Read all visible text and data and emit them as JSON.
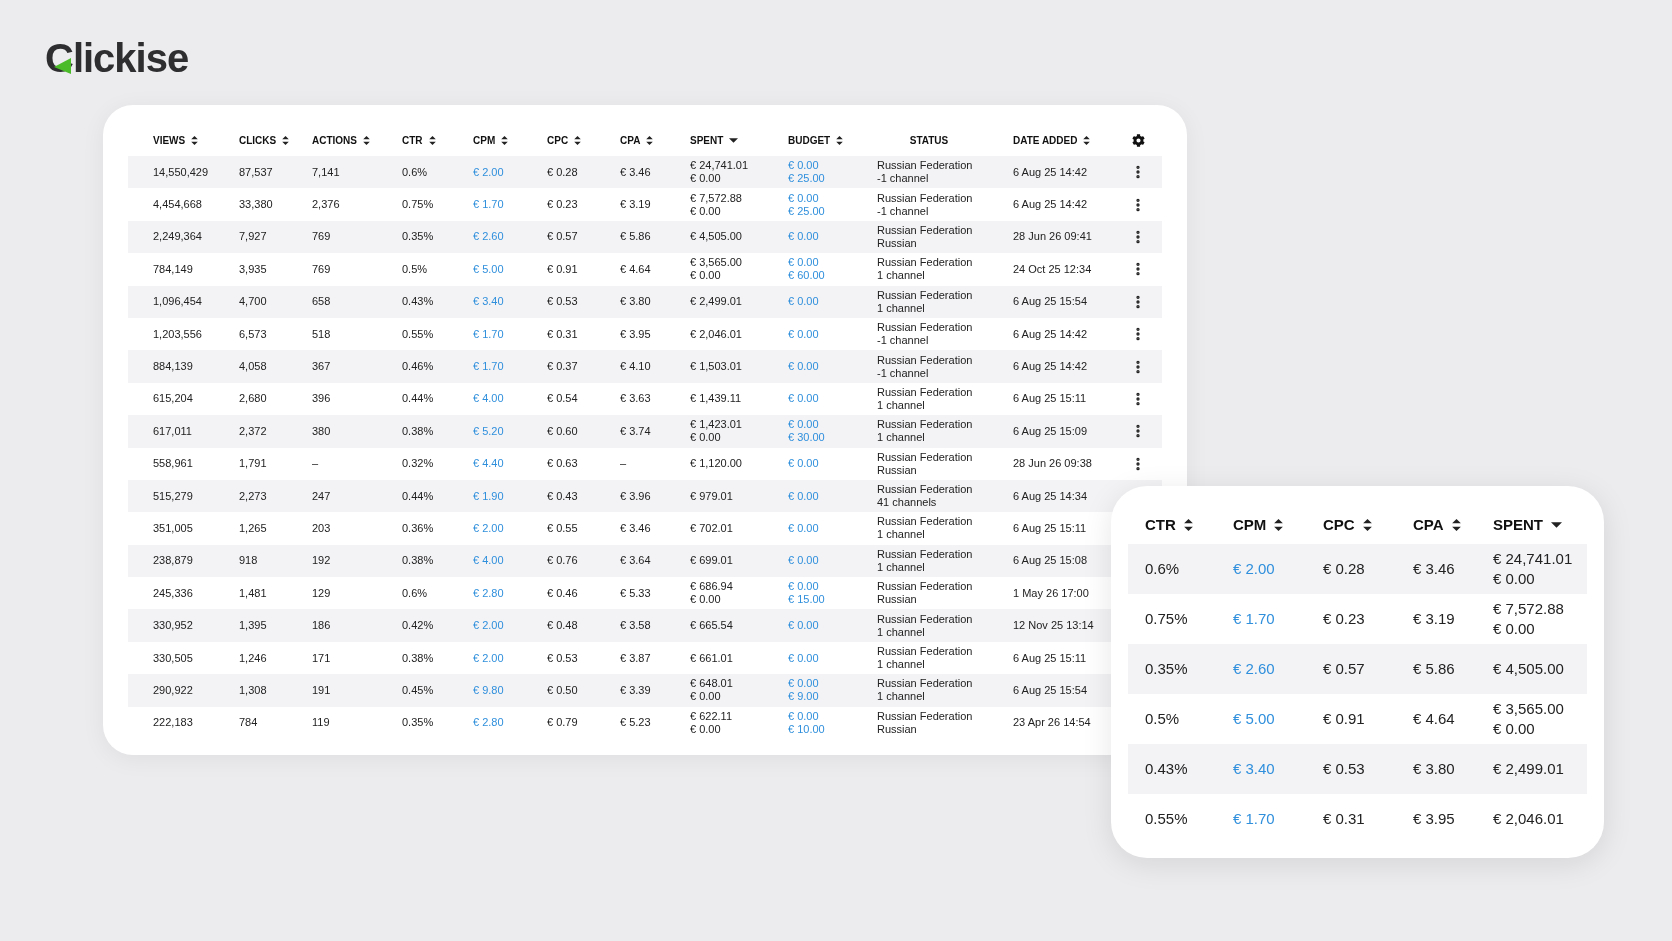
{
  "logo": "Clickise",
  "table": {
    "columns": [
      {
        "label": "VIEWS",
        "sortable": true,
        "sorted": false,
        "link": false
      },
      {
        "label": "CLICKS",
        "sortable": true,
        "sorted": false,
        "link": false
      },
      {
        "label": "ACTIONS",
        "sortable": true,
        "sorted": false,
        "link": false
      },
      {
        "label": "CTR",
        "sortable": true,
        "sorted": false,
        "link": false
      },
      {
        "label": "CPM",
        "sortable": true,
        "sorted": false,
        "link": true
      },
      {
        "label": "CPC",
        "sortable": true,
        "sorted": false,
        "link": false
      },
      {
        "label": "CPA",
        "sortable": true,
        "sorted": false,
        "link": false
      },
      {
        "label": "SPENT",
        "sortable": true,
        "sorted": true,
        "link": false
      },
      {
        "label": "BUDGET",
        "sortable": true,
        "sorted": false,
        "link": true
      },
      {
        "label": "STATUS",
        "sortable": false,
        "sorted": false,
        "link": false
      },
      {
        "label": "DATE ADDED",
        "sortable": true,
        "sorted": false,
        "link": false
      }
    ],
    "rows": [
      {
        "cells": [
          [
            "14,550,429"
          ],
          [
            "87,537"
          ],
          [
            "7,141"
          ],
          [
            "0.6%"
          ],
          [
            "€ 2.00"
          ],
          [
            "€ 0.28"
          ],
          [
            "€ 3.46"
          ],
          [
            "€ 24,741.01",
            "€ 0.00"
          ],
          [
            "€ 0.00",
            "€ 25.00"
          ],
          [
            "Russian Federation",
            "-1 channel"
          ],
          [
            "6 Aug 25 14:42"
          ]
        ]
      },
      {
        "cells": [
          [
            "4,454,668"
          ],
          [
            "33,380"
          ],
          [
            "2,376"
          ],
          [
            "0.75%"
          ],
          [
            "€ 1.70"
          ],
          [
            "€ 0.23"
          ],
          [
            "€ 3.19"
          ],
          [
            "€ 7,572.88",
            "€ 0.00"
          ],
          [
            "€ 0.00",
            "€ 25.00"
          ],
          [
            "Russian Federation",
            "-1 channel"
          ],
          [
            "6 Aug 25 14:42"
          ]
        ]
      },
      {
        "cells": [
          [
            "2,249,364"
          ],
          [
            "7,927"
          ],
          [
            "769"
          ],
          [
            "0.35%"
          ],
          [
            "€ 2.60"
          ],
          [
            "€ 0.57"
          ],
          [
            "€ 5.86"
          ],
          [
            "€ 4,505.00"
          ],
          [
            "€ 0.00"
          ],
          [
            "Russian Federation",
            "Russian"
          ],
          [
            "28 Jun 26 09:41"
          ]
        ]
      },
      {
        "cells": [
          [
            "784,149"
          ],
          [
            "3,935"
          ],
          [
            "769"
          ],
          [
            "0.5%"
          ],
          [
            "€ 5.00"
          ],
          [
            "€ 0.91"
          ],
          [
            "€ 4.64"
          ],
          [
            "€ 3,565.00",
            "€ 0.00"
          ],
          [
            "€ 0.00",
            "€ 60.00"
          ],
          [
            "Russian Federation",
            "1 channel"
          ],
          [
            "24 Oct 25 12:34"
          ]
        ]
      },
      {
        "cells": [
          [
            "1,096,454"
          ],
          [
            "4,700"
          ],
          [
            "658"
          ],
          [
            "0.43%"
          ],
          [
            "€ 3.40"
          ],
          [
            "€ 0.53"
          ],
          [
            "€ 3.80"
          ],
          [
            "€ 2,499.01"
          ],
          [
            "€ 0.00"
          ],
          [
            "Russian Federation",
            "1 channel"
          ],
          [
            "6 Aug 25 15:54"
          ]
        ]
      },
      {
        "cells": [
          [
            "1,203,556"
          ],
          [
            "6,573"
          ],
          [
            "518"
          ],
          [
            "0.55%"
          ],
          [
            "€ 1.70"
          ],
          [
            "€ 0.31"
          ],
          [
            "€ 3.95"
          ],
          [
            "€ 2,046.01"
          ],
          [
            "€ 0.00"
          ],
          [
            "Russian Federation",
            "-1 channel"
          ],
          [
            "6 Aug 25 14:42"
          ]
        ]
      },
      {
        "cells": [
          [
            "884,139"
          ],
          [
            "4,058"
          ],
          [
            "367"
          ],
          [
            "0.46%"
          ],
          [
            "€ 1.70"
          ],
          [
            "€ 0.37"
          ],
          [
            "€ 4.10"
          ],
          [
            "€ 1,503.01"
          ],
          [
            "€ 0.00"
          ],
          [
            "Russian Federation",
            "-1 channel"
          ],
          [
            "6 Aug 25 14:42"
          ]
        ]
      },
      {
        "cells": [
          [
            "615,204"
          ],
          [
            "2,680"
          ],
          [
            "396"
          ],
          [
            "0.44%"
          ],
          [
            "€ 4.00"
          ],
          [
            "€ 0.54"
          ],
          [
            "€ 3.63"
          ],
          [
            "€ 1,439.11"
          ],
          [
            "€ 0.00"
          ],
          [
            "Russian Federation",
            "1 channel"
          ],
          [
            "6 Aug 25 15:11"
          ]
        ]
      },
      {
        "cells": [
          [
            "617,011"
          ],
          [
            "2,372"
          ],
          [
            "380"
          ],
          [
            "0.38%"
          ],
          [
            "€ 5.20"
          ],
          [
            "€ 0.60"
          ],
          [
            "€ 3.74"
          ],
          [
            "€ 1,423.01",
            "€ 0.00"
          ],
          [
            "€ 0.00",
            "€ 30.00"
          ],
          [
            "Russian Federation",
            "1 channel"
          ],
          [
            "6 Aug 25 15:09"
          ]
        ]
      },
      {
        "cells": [
          [
            "558,961"
          ],
          [
            "1,791"
          ],
          [
            "–"
          ],
          [
            "0.32%"
          ],
          [
            "€ 4.40"
          ],
          [
            "€ 0.63"
          ],
          [
            "–"
          ],
          [
            "€ 1,120.00"
          ],
          [
            "€ 0.00"
          ],
          [
            "Russian Federation",
            "Russian"
          ],
          [
            "28 Jun 26 09:38"
          ]
        ]
      },
      {
        "cells": [
          [
            "515,279"
          ],
          [
            "2,273"
          ],
          [
            "247"
          ],
          [
            "0.44%"
          ],
          [
            "€ 1.90"
          ],
          [
            "€ 0.43"
          ],
          [
            "€ 3.96"
          ],
          [
            "€ 979.01"
          ],
          [
            "€ 0.00"
          ],
          [
            "Russian Federation",
            "41 channels"
          ],
          [
            "6 Aug 25 14:34"
          ]
        ]
      },
      {
        "cells": [
          [
            "351,005"
          ],
          [
            "1,265"
          ],
          [
            "203"
          ],
          [
            "0.36%"
          ],
          [
            "€ 2.00"
          ],
          [
            "€ 0.55"
          ],
          [
            "€ 3.46"
          ],
          [
            "€ 702.01"
          ],
          [
            "€ 0.00"
          ],
          [
            "Russian Federation",
            "1 channel"
          ],
          [
            "6 Aug 25 15:11"
          ]
        ]
      },
      {
        "cells": [
          [
            "238,879"
          ],
          [
            "918"
          ],
          [
            "192"
          ],
          [
            "0.38%"
          ],
          [
            "€ 4.00"
          ],
          [
            "€ 0.76"
          ],
          [
            "€ 3.64"
          ],
          [
            "€ 699.01"
          ],
          [
            "€ 0.00"
          ],
          [
            "Russian Federation",
            "1 channel"
          ],
          [
            "6 Aug 25 15:08"
          ]
        ]
      },
      {
        "cells": [
          [
            "245,336"
          ],
          [
            "1,481"
          ],
          [
            "129"
          ],
          [
            "0.6%"
          ],
          [
            "€ 2.80"
          ],
          [
            "€ 0.46"
          ],
          [
            "€ 5.33"
          ],
          [
            "€ 686.94",
            "€ 0.00"
          ],
          [
            "€ 0.00",
            "€ 15.00"
          ],
          [
            "Russian Federation",
            "Russian"
          ],
          [
            "1 May 26 17:00"
          ]
        ]
      },
      {
        "cells": [
          [
            "330,952"
          ],
          [
            "1,395"
          ],
          [
            "186"
          ],
          [
            "0.42%"
          ],
          [
            "€ 2.00"
          ],
          [
            "€ 0.48"
          ],
          [
            "€ 3.58"
          ],
          [
            "€ 665.54"
          ],
          [
            "€ 0.00"
          ],
          [
            "Russian Federation",
            "1 channel"
          ],
          [
            "12 Nov 25 13:14"
          ]
        ]
      },
      {
        "cells": [
          [
            "330,505"
          ],
          [
            "1,246"
          ],
          [
            "171"
          ],
          [
            "0.38%"
          ],
          [
            "€ 2.00"
          ],
          [
            "€ 0.53"
          ],
          [
            "€ 3.87"
          ],
          [
            "€ 661.01"
          ],
          [
            "€ 0.00"
          ],
          [
            "Russian Federation",
            "1 channel"
          ],
          [
            "6 Aug 25 15:11"
          ]
        ]
      },
      {
        "cells": [
          [
            "290,922"
          ],
          [
            "1,308"
          ],
          [
            "191"
          ],
          [
            "0.45%"
          ],
          [
            "€ 9.80"
          ],
          [
            "€ 0.50"
          ],
          [
            "€ 3.39"
          ],
          [
            "€ 648.01",
            "€ 0.00"
          ],
          [
            "€ 0.00",
            "€ 9.00"
          ],
          [
            "Russian Federation",
            "1 channel"
          ],
          [
            "6 Aug 25 15:54"
          ]
        ]
      },
      {
        "cells": [
          [
            "222,183"
          ],
          [
            "784"
          ],
          [
            "119"
          ],
          [
            "0.35%"
          ],
          [
            "€ 2.80"
          ],
          [
            "€ 0.79"
          ],
          [
            "€ 5.23"
          ],
          [
            "€ 622.11",
            "€ 0.00"
          ],
          [
            "€ 0.00",
            "€ 10.00"
          ],
          [
            "Russian Federation",
            "Russian"
          ],
          [
            "23 Apr 26 14:54"
          ]
        ]
      }
    ]
  },
  "zoom_card": {
    "columns": [
      {
        "label": "CTR",
        "sortable": true,
        "sorted": false,
        "link": false
      },
      {
        "label": "CPM",
        "sortable": true,
        "sorted": false,
        "link": true
      },
      {
        "label": "CPC",
        "sortable": true,
        "sorted": false,
        "link": false
      },
      {
        "label": "CPA",
        "sortable": true,
        "sorted": false,
        "link": false
      },
      {
        "label": "SPENT",
        "sortable": true,
        "sorted": true,
        "link": false
      }
    ],
    "rows": [
      {
        "cells": [
          [
            "0.6%"
          ],
          [
            "€ 2.00"
          ],
          [
            "€ 0.28"
          ],
          [
            "€ 3.46"
          ],
          [
            "€ 24,741.01",
            "€ 0.00"
          ]
        ]
      },
      {
        "cells": [
          [
            "0.75%"
          ],
          [
            "€ 1.70"
          ],
          [
            "€ 0.23"
          ],
          [
            "€ 3.19"
          ],
          [
            "€ 7,572.88",
            "€ 0.00"
          ]
        ]
      },
      {
        "cells": [
          [
            "0.35%"
          ],
          [
            "€ 2.60"
          ],
          [
            "€ 0.57"
          ],
          [
            "€ 5.86"
          ],
          [
            "€ 4,505.00"
          ]
        ]
      },
      {
        "cells": [
          [
            "0.5%"
          ],
          [
            "€ 5.00"
          ],
          [
            "€ 0.91"
          ],
          [
            "€ 4.64"
          ],
          [
            "€ 3,565.00",
            "€ 0.00"
          ]
        ]
      },
      {
        "cells": [
          [
            "0.43%"
          ],
          [
            "€ 3.40"
          ],
          [
            "€ 0.53"
          ],
          [
            "€ 3.80"
          ],
          [
            "€ 2,499.01"
          ]
        ]
      },
      {
        "cells": [
          [
            "0.55%"
          ],
          [
            "€ 1.70"
          ],
          [
            "€ 0.31"
          ],
          [
            "€ 3.95"
          ],
          [
            "€ 2,046.01"
          ]
        ]
      }
    ]
  }
}
